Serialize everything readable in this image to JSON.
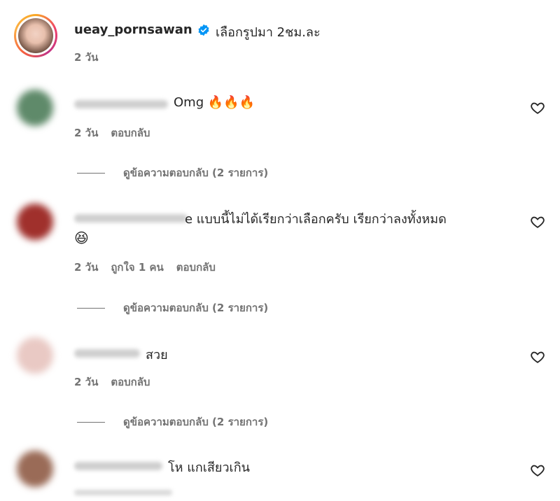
{
  "post": {
    "username": "ueay_pornsawan",
    "caption": "เลือกรูปมา 2ชม.ละ",
    "time": "2 วัน"
  },
  "comments": [
    {
      "text": "Omg",
      "emoji": "🔥🔥🔥",
      "time": "2 วัน",
      "reply_label": "ตอบกลับ",
      "likes": "",
      "view_replies": "ดูข้อความตอบกลับ (2 รายการ)",
      "avatar_color": "#5f8a6a"
    },
    {
      "text": "e แบบนี้ไม่ได้เรียกว่าเลือกครับ เรียกว่าลงทั้งหมด",
      "emoji": "😆",
      "time": "2 วัน",
      "likes": "ถูกใจ 1 คน",
      "reply_label": "ตอบกลับ",
      "view_replies": "ดูข้อความตอบกลับ (2 รายการ)",
      "avatar_color": "#a0302c"
    },
    {
      "text": "สวย",
      "emoji": "",
      "time": "2 วัน",
      "reply_label": "ตอบกลับ",
      "likes": "",
      "view_replies": "ดูข้อความตอบกลับ (2 รายการ)",
      "avatar_color": "#e9c9c4"
    },
    {
      "text": "โห แกเสียวเกิน",
      "emoji": "",
      "time": "2 วัน",
      "reply_label": "",
      "likes": "",
      "view_replies": "",
      "avatar_color": "#9a6b57"
    }
  ],
  "icons": {
    "verified": "verified-badge-icon",
    "heart": "heart-outline-icon"
  },
  "colors": {
    "verified_blue": "#0095f6",
    "meta_gray": "#737373",
    "text_dark": "#262626"
  }
}
